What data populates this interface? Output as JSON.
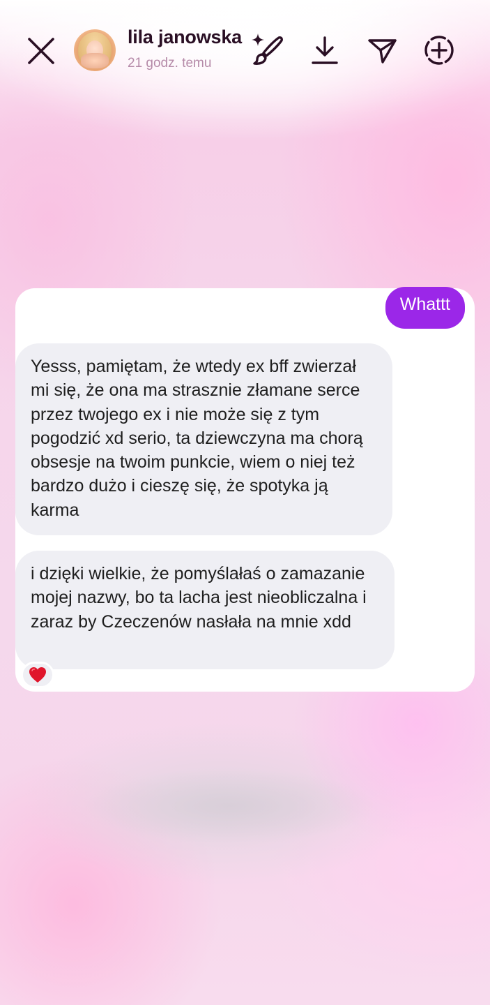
{
  "header": {
    "username": "lila janowska",
    "timestamp": "21 godz. temu",
    "icons": [
      "close-icon",
      "avatar",
      "sparkle-icon",
      "brush-icon",
      "download-icon",
      "send-icon",
      "add-circle-icon"
    ]
  },
  "chat": {
    "sent_message": "Whattt",
    "received_messages": [
      "Yesss, pamiętam, że wtedy ex bff zwierzał mi się, że ona ma strasznie złamane serce przez twojego ex i nie może się z tym pogodzić xd serio, ta dziewczyna ma chorą obsesje na twoim punkcie, wiem o niej też bardzo dużo i cieszę się, że spotyka ją karma",
      "i dzięki wielkie, że pomyślałaś o zamazanie mojej nazwy, bo ta lacha jest nieobliczalna i zaraz by Czeczenów nasłała na mnie xdd"
    ],
    "reaction": "heart-icon"
  },
  "colors": {
    "sent_bubble": "#9b27e8",
    "received_bubble": "#efeff4",
    "header_text": "#2a0f24",
    "timestamp_text": "#b58aa8",
    "background": "#f6d2ea",
    "heart": "#e0152b"
  }
}
